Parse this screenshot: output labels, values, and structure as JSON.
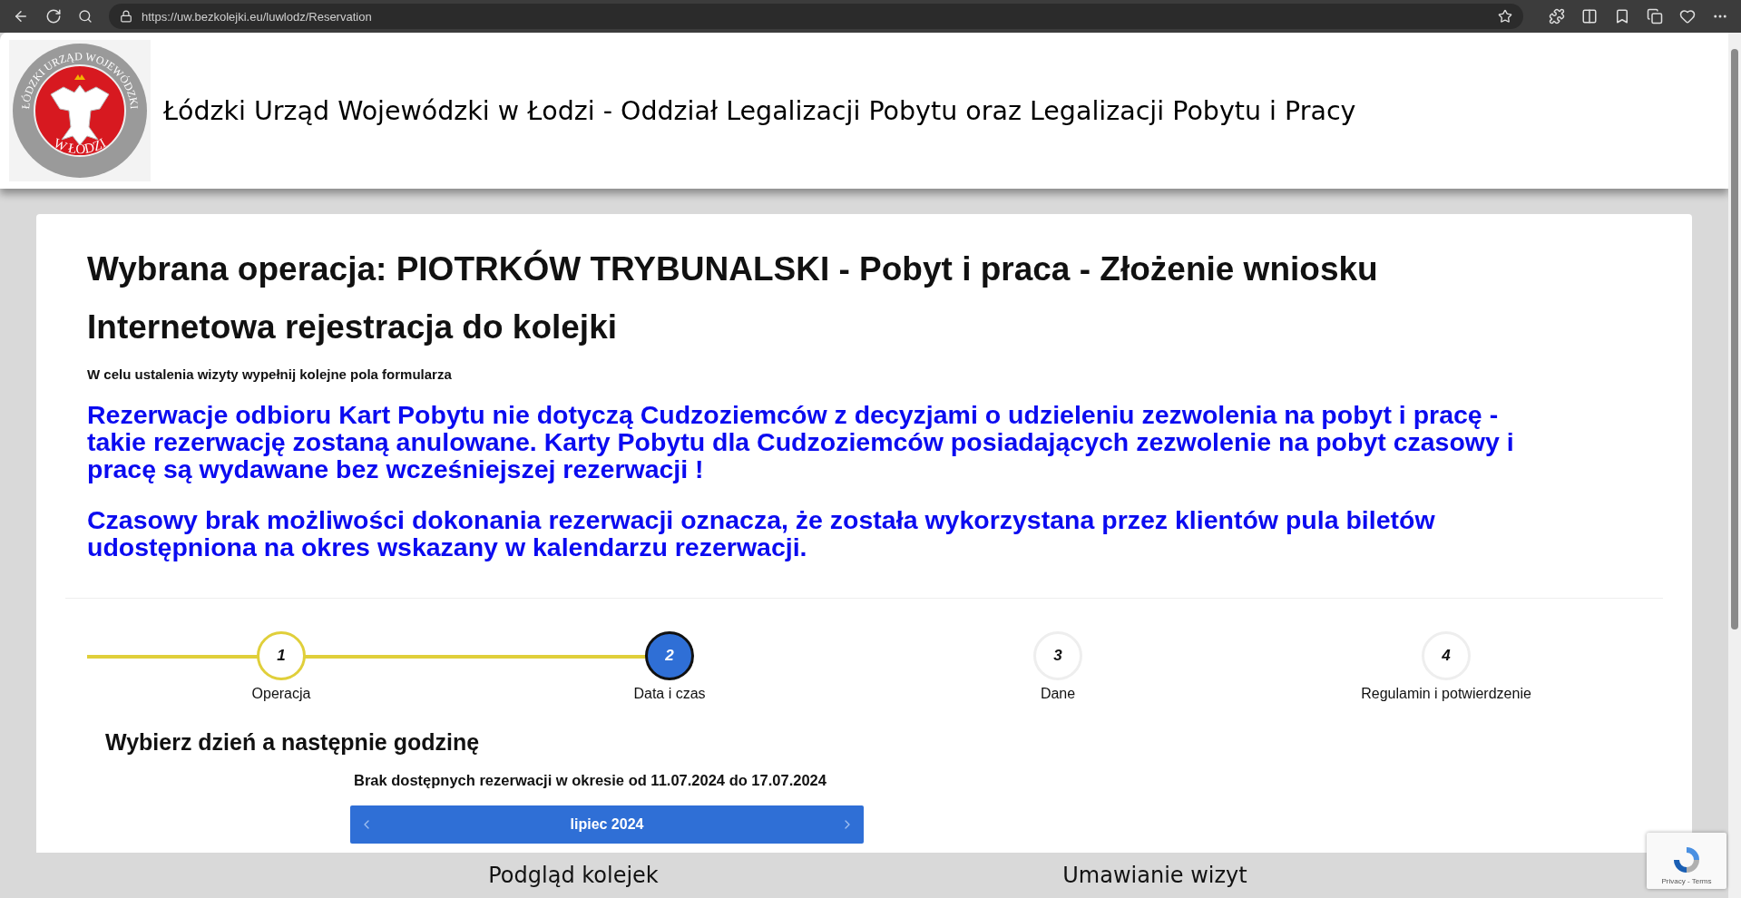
{
  "browser": {
    "url": "https://uw.bezkolejki.eu/luwlodz/Reservation"
  },
  "header": {
    "logo_ring_top": "ŁÓDZKI URZĄD WOJEWÓDZKI",
    "logo_ring_bottom": "W ŁODZI",
    "title": "Łódzki Urząd Wojewódzki w Łodzi - Oddział Legalizacji Pobytu oraz Legalizacji Pobytu i Pracy"
  },
  "card": {
    "operation": "Wybrana operacja: PIOTRKÓW TRYBUNALSKI - Pobyt i praca - Złożenie wniosku",
    "title": "Internetowa rejestracja do kolejki",
    "subtitle": "W celu ustalenia wizyty wypełnij kolejne pola formularza",
    "notices": [
      "Rezerwacje odbioru Kart Pobytu  nie dotyczą Cudzoziemców z decyzjami o udzieleniu zezwolenia na pobyt i pracę - takie rezerwację zostaną anulowane. Karty Pobytu dla Cudzoziemców posiadających zezwolenie na pobyt czasowy i pracę są wydawane bez wcześniejszej rezerwacji !",
      "Czasowy brak możliwości dokonania rezerwacji oznacza, że została wykorzystana przez klientów pula biletów udostępniona na okres wskazany w kalendarzu rezerwacji."
    ],
    "steps": [
      {
        "number": "1",
        "label": "Operacja",
        "selected": false,
        "completed": true
      },
      {
        "number": "2",
        "label": "Data i czas",
        "selected": true,
        "completed": false
      },
      {
        "number": "3",
        "label": "Dane",
        "selected": false,
        "completed": false
      },
      {
        "number": "4",
        "label": "Regulamin i potwierdzenie",
        "selected": false,
        "completed": false
      }
    ],
    "section_title": "Wybierz dzień a następnie godzinę",
    "availability": "Brak dostępnych rezerwacji w okresie od 11.07.2024 do 17.07.2024",
    "calendar": {
      "month": "lipiec 2024"
    }
  },
  "footer": {
    "links": [
      "Podgląd kolejek",
      "Umawianie wizyt"
    ]
  },
  "recaptcha": {
    "links": "Privacy - Terms"
  }
}
